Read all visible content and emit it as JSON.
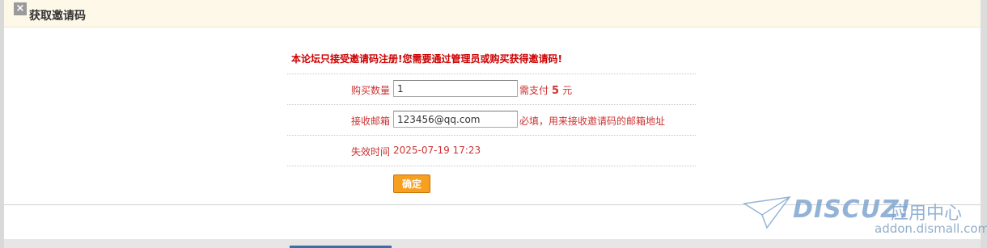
{
  "dialog": {
    "title": "获取邀请码",
    "close_label": "×"
  },
  "form": {
    "notice": "本论坛只接受邀请码注册!您需要通过管理员或购买获得邀请码!",
    "quantity": {
      "label": "购买数量",
      "value": "1",
      "pay_prefix": "需支付",
      "price": "5",
      "unit": "元"
    },
    "email": {
      "label": "接收邮箱",
      "value": "123456@qq.com",
      "hint": "必填，用来接收邀请码的邮箱地址"
    },
    "expire": {
      "label": "失效时间",
      "value": "2025-07-19 17:23"
    },
    "submit_label": "确定"
  },
  "watermark": {
    "logo": "DISCUZ!",
    "subtitle": "应用中心",
    "url": "addon.dismall.com"
  },
  "colors": {
    "accent_red": "#cc3333",
    "header_bg": "#fdf8e8",
    "button_orange": "#f7a020"
  }
}
